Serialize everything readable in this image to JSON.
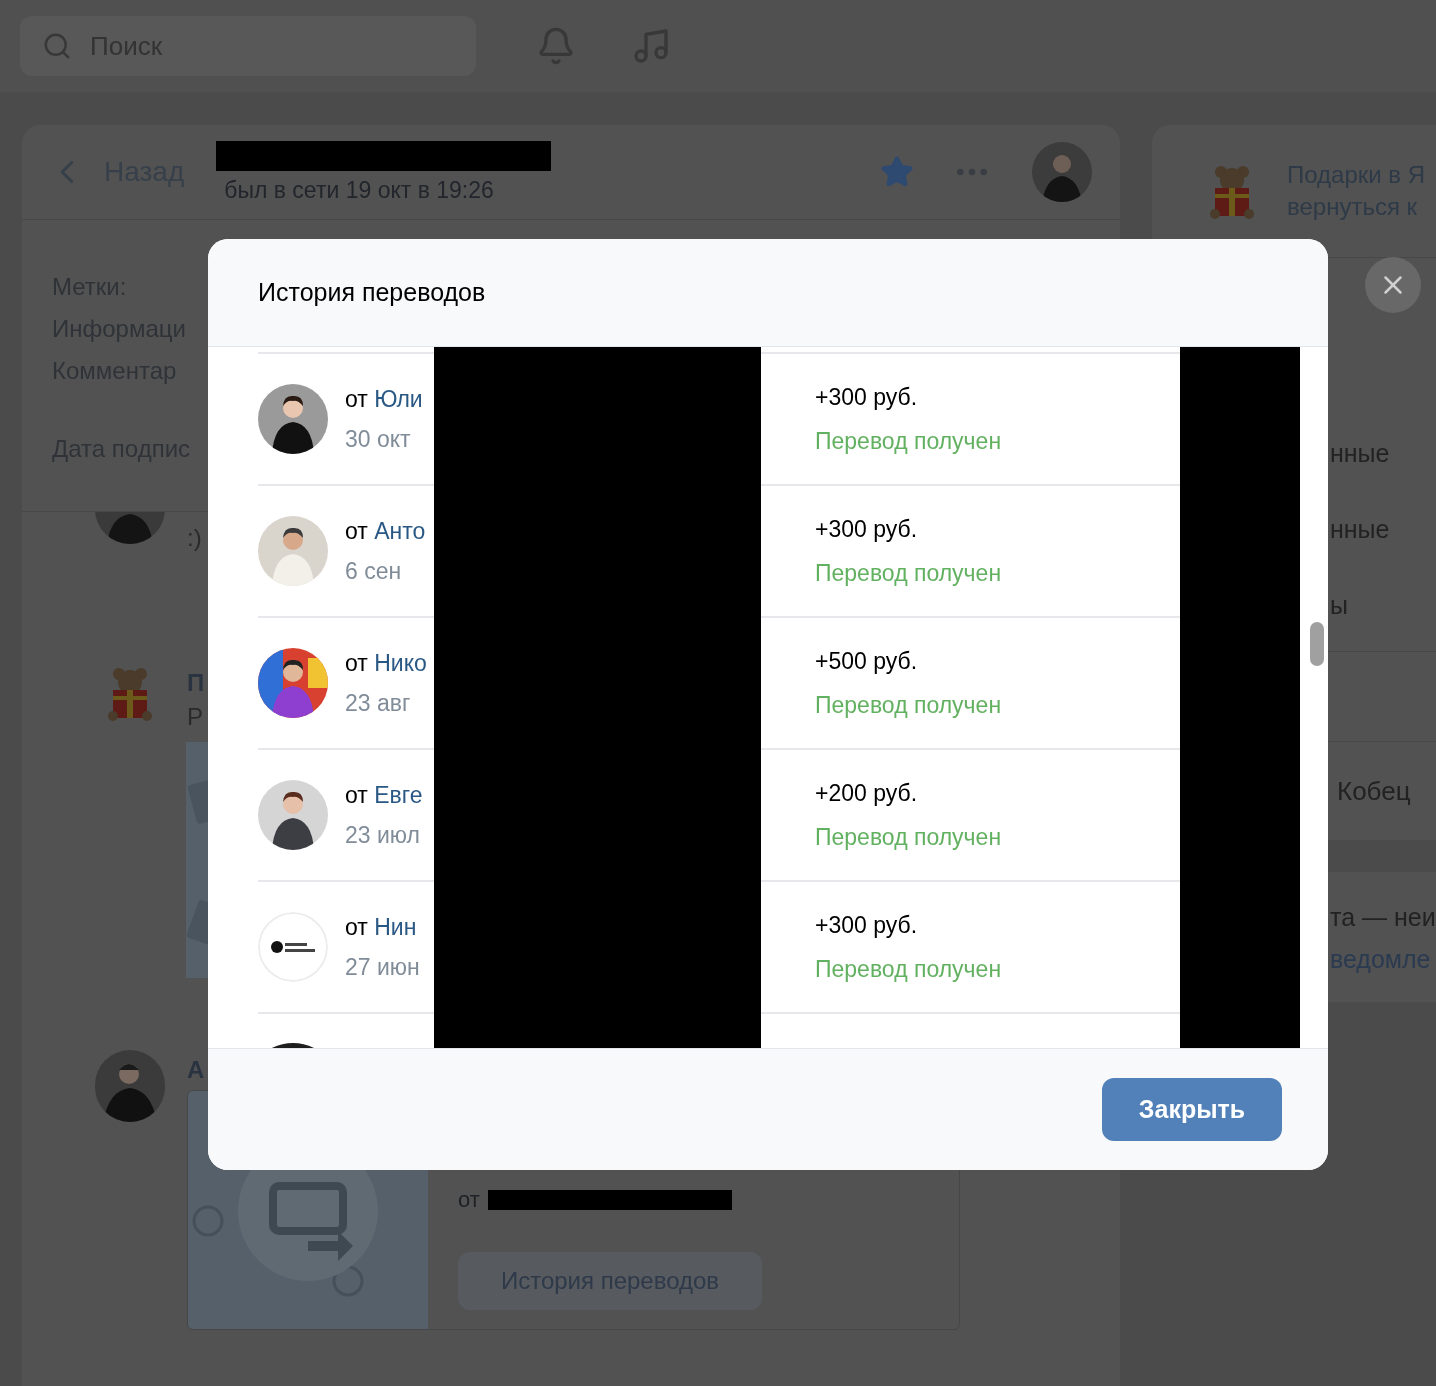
{
  "top_bar": {
    "search": {
      "placeholder": "Поиск"
    }
  },
  "chat_header": {
    "back": "Назад",
    "status": "был в сети 19 окт в 19:26"
  },
  "profile_info": {
    "labels": [
      "Метки:",
      "Информаци",
      "Комментар"
    ],
    "subscription": "Дата подпис"
  },
  "messages": [
    {
      "kind": "text",
      "text": ":)"
    },
    {
      "kind": "gift",
      "author": "П",
      "text": "Р"
    },
    {
      "kind": "transfer",
      "author": "А",
      "from": "от",
      "button": "История переводов"
    }
  ],
  "right_panel": {
    "promo": [
      "Подарки в Я",
      "вернуться к"
    ],
    "menu": [
      "нные",
      "нные",
      "ы"
    ],
    "contact": "Кобец",
    "notice": [
      "та — неи",
      "ведомле"
    ]
  },
  "modal": {
    "title": "История переводов",
    "transfers": [
      {
        "from": "от",
        "name": "Юли",
        "date": "30 окт",
        "amount": "+300 руб.",
        "status": "Перевод получен"
      },
      {
        "from": "от",
        "name": "Анто",
        "date": "6 сен",
        "amount": "+300 руб.",
        "status": "Перевод получен"
      },
      {
        "from": "от",
        "name": "Нико",
        "date": "23 авг",
        "amount": "+500 руб.",
        "status": "Перевод получен"
      },
      {
        "from": "от",
        "name": "Евге",
        "date": "23 июл",
        "amount": "+200 руб.",
        "status": "Перевод получен"
      },
      {
        "from": "от",
        "name": "Нин",
        "date": "27 июн",
        "amount": "+300 руб.",
        "status": "Перевод получен"
      }
    ],
    "close_button": "Закрыть"
  }
}
